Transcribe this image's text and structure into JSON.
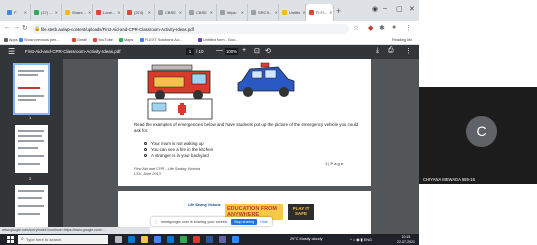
{
  "browser": {
    "tabs": [
      {
        "label": "F",
        "color": "#4285f4"
      },
      {
        "label": "(17) ...",
        "color": "#34a853"
      },
      {
        "label": "Share...",
        "color": "#fbbc05"
      },
      {
        "label": "Lone...",
        "color": "#ea4335"
      },
      {
        "label": "(374)",
        "color": "#ea4335"
      },
      {
        "label": "CBSE",
        "color": "#9aa0a6"
      },
      {
        "label": "CBSE",
        "color": "#9aa0a6"
      },
      {
        "label": "https:",
        "color": "#9aa0a6"
      },
      {
        "label": "SRCS...",
        "color": "#9aa0a6"
      },
      {
        "label": "Untitle",
        "color": "#fbbc05"
      },
      {
        "label": "Fi Fi...",
        "color": "#ea4335"
      }
    ],
    "new_tab": "+",
    "minimize": "–",
    "maximize": "▢",
    "close": "✕",
    "url": "file.stetb.au/wp-content/uploads/First-Aid-and-CPR-Classroom-Activity-Ideas.pdf",
    "bookmarks": [
      {
        "label": "Apps",
        "color": "#5f6368"
      },
      {
        "label": "Show previous pen...",
        "color": "#4285f4"
      },
      {
        "label": "Gmail",
        "color": "#ea4335"
      },
      {
        "label": "YouTube",
        "color": "#ea4335"
      },
      {
        "label": "Maps",
        "color": "#34a853"
      },
      {
        "label": "FLEXT Solutions Au...",
        "color": "#4285f4"
      },
      {
        "label": "Untitled form - Goo...",
        "color": "#673ab7"
      }
    ],
    "reading_list": "Reading list"
  },
  "pdf": {
    "menu_icon": "☰",
    "title": "First-Aid-and-CPR-Classroom-Activity-Ideas.pdf",
    "page_current": "1",
    "page_total": "/ 10",
    "zoom_out": "—",
    "zoom": "100%",
    "zoom_in": "+",
    "instruction": "Read the examples of emergencies below and have students put up the picture of the emergency vehicle you could ask for.",
    "bullets": [
      "Your mum is not waking up",
      "You can see a fire in the kitchen",
      "A stranger is in your backyard"
    ],
    "page_label": "1 | P a g e",
    "footer_line1": "First Aid and CPR - Life Saving Victoria",
    "footer_line2": "LSV, June 2013",
    "thumb_numbers": [
      "1",
      "2"
    ]
  },
  "banner": {
    "left": "Life Saving Victoria",
    "mid": "EDUCATION FROM ANYWHERE",
    "right": "PLAY IT SAFE"
  },
  "sharing": {
    "text": "meetgoogle.com is sharing your screen.",
    "stop": "Stop sharing",
    "hide": "Hide"
  },
  "status_url": "www.google.com/sorry/index?continue=https://www.google.com/...",
  "taskbar": {
    "search_placeholder": "Type here to search",
    "weather": "29°C Mostly cloudy",
    "lang": "ENG",
    "time": "10:15",
    "date": "22-07-2021"
  },
  "meet": {
    "avatar_letter": "C",
    "participant_name": "CHIYANA MEWADA 659-16"
  }
}
